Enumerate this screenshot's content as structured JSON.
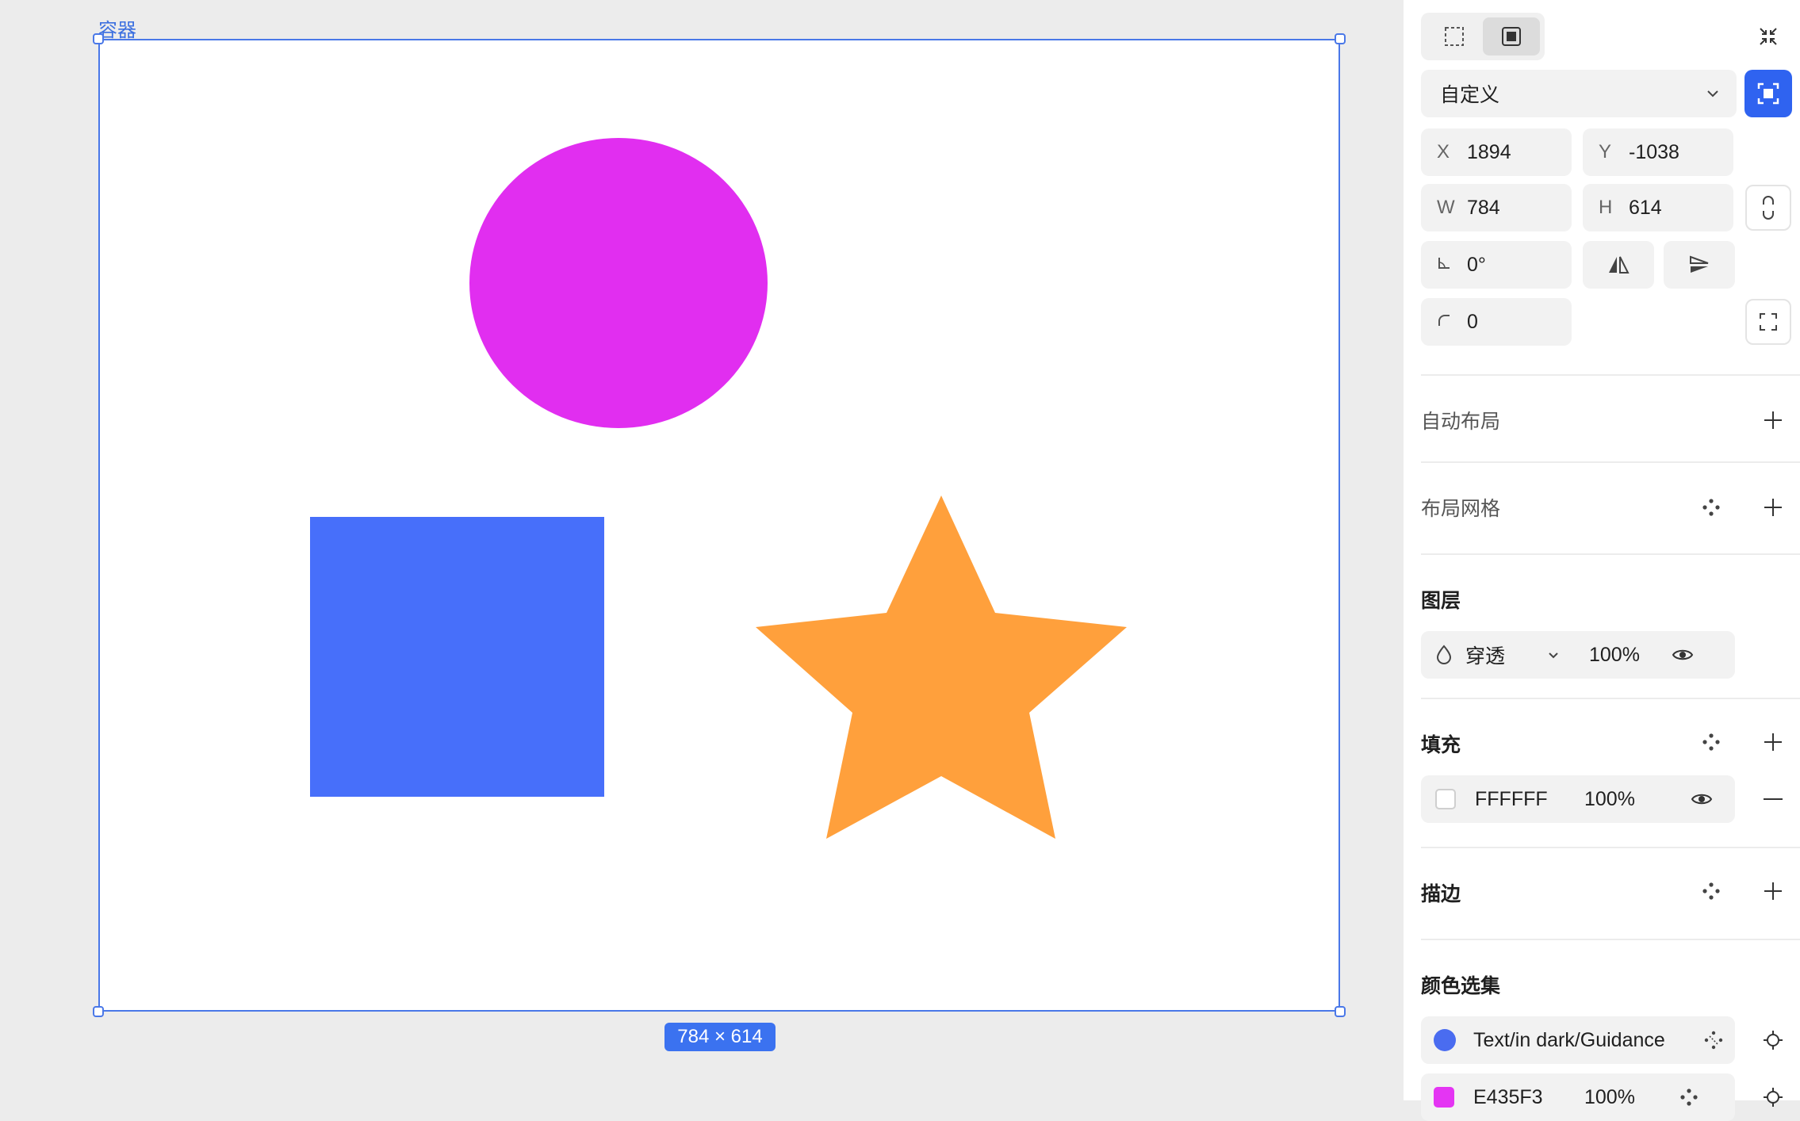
{
  "canvas": {
    "frame_label": "容器",
    "size_badge": "784 × 614",
    "shapes": [
      {
        "name": "circle",
        "color": "#e12ef0"
      },
      {
        "name": "square",
        "color": "#476ffa"
      },
      {
        "name": "star",
        "color": "#ffa03c"
      }
    ]
  },
  "panel": {
    "preset": {
      "value": "自定义"
    },
    "x": {
      "label": "X",
      "value": "1894"
    },
    "y": {
      "label": "Y",
      "value": "-1038"
    },
    "w": {
      "label": "W",
      "value": "784"
    },
    "h": {
      "label": "H",
      "value": "614"
    },
    "rotation": {
      "value": "0°"
    },
    "radius": {
      "value": "0"
    },
    "sections": {
      "auto_layout": "自动布局",
      "layout_grid": "布局网格",
      "layer": "图层",
      "fill": "填充",
      "stroke": "描边",
      "color_selection": "颜色选集"
    },
    "layer": {
      "blend": "穿透",
      "opacity": "100%"
    },
    "fill": {
      "hex": "FFFFFF",
      "opacity": "100%",
      "color": "#ffffff"
    },
    "color_selection": [
      {
        "name": "Text/in dark/Guidance",
        "color": "#4a6cf0"
      },
      {
        "name": "E435F3",
        "opacity": "100%",
        "color": "#e435f3"
      }
    ],
    "accent": "#2f63f0"
  }
}
